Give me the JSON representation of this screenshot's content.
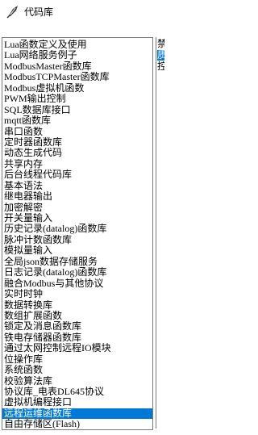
{
  "window": {
    "title": "代码库",
    "icon": "feather-pen-icon"
  },
  "list": {
    "items": [
      "Lua函数定义及使用",
      "Lua网络服务例子",
      "ModbusMaster函数库",
      "ModbusTCPMaster函数库",
      "Modbus虚拟机函数",
      "PWM输出控制",
      "SQL数据库接口",
      "mqtt函数库",
      "串口函数",
      "定时器函数库",
      "动态生成代码",
      "共享内存",
      "后台线程代码库",
      "基本语法",
      "继电器输出",
      "加密解密",
      "开关量输入",
      "历史记录(datalog)函数库",
      "脉冲计数函数库",
      "模拟量输入",
      "全局json数据存储服务",
      "日志记录(datalog)函数库",
      "融合Modbus与其他协议",
      "实时时钟",
      "数据转换库",
      "数组扩展函数",
      "锁定及消息函数库",
      "铁电存储器函数库",
      "通过太网控制远程IO模块",
      "位操作库",
      "系统函数",
      "校验算法库",
      "协议库_电表DL645协议",
      "虚拟机编程接口",
      "远程运维函数库",
      "自由存储区(Flash)"
    ],
    "selected_index": 34
  },
  "right_panel": {
    "fragments": [
      "禁",
      "质",
      "控"
    ]
  }
}
